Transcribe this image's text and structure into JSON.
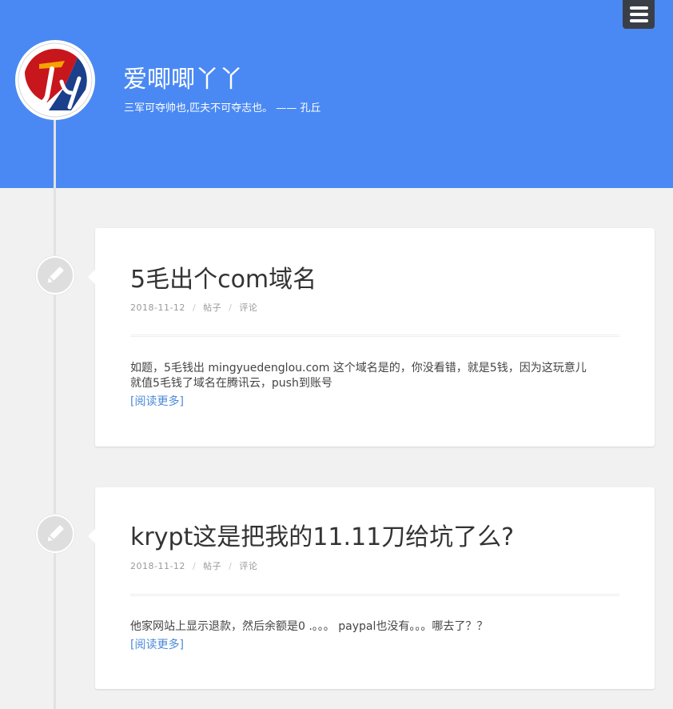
{
  "header": {
    "site_title": "爱唧唧丫丫",
    "motto": "三军可夺帅也,匹夫不可夺志也。 —— 孔丘",
    "avatar_letters": "Jy",
    "menu_icon": "hamburger-icon",
    "colors": {
      "header_bg": "#4a89f3",
      "menu_bg": "#3a3f47",
      "link": "#4a89d8",
      "page_bg": "#f1f1f1"
    }
  },
  "posts": [
    {
      "icon": "pencil-icon",
      "title": "5毛出个com域名",
      "date": "2018-11-12",
      "category": "帖子",
      "comments": "评论",
      "excerpt_line1": "如题，5毛钱出 mingyuedenglou.com 这个域名是的，你没看错，就是5钱，因为这玩意儿",
      "excerpt_line2": "就值5毛钱了域名在腾讯云，push到账号",
      "read_more": "[阅读更多]"
    },
    {
      "icon": "pencil-icon",
      "title": "krypt这是把我的11.11刀给坑了么?",
      "date": "2018-11-12",
      "category": "帖子",
      "comments": "评论",
      "excerpt_line1": "他家网站上显示退款，然后余额是0 .。。。   paypal也没有。。。哪去了？？",
      "read_more": "[阅读更多]"
    }
  ],
  "meta_separator": "/"
}
